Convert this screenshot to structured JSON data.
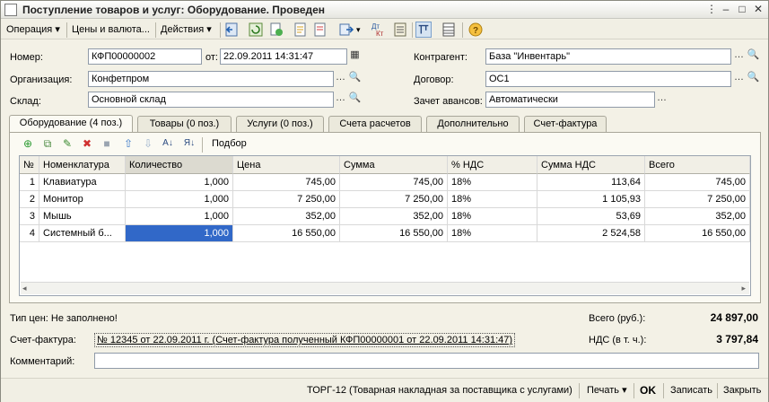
{
  "window": {
    "title": "Поступление товаров и услуг: Оборудование. Проведен"
  },
  "toolbar": {
    "operation": "Операция",
    "prices": "Цены и валюта...",
    "actions": "Действия"
  },
  "form": {
    "number_label": "Номер:",
    "number_value": "КФП00000002",
    "date_label": "от:",
    "date_value": "22.09.2011 14:31:47",
    "org_label": "Организация:",
    "org_value": "Конфетпром",
    "warehouse_label": "Склад:",
    "warehouse_value": "Основной склад",
    "counterparty_label": "Контрагент:",
    "counterparty_value": "База \"Инвентарь\"",
    "contract_label": "Договор:",
    "contract_value": "ОС1",
    "advance_label": "Зачет авансов:",
    "advance_value": "Автоматически"
  },
  "tabs": [
    {
      "label": "Оборудование (4 поз.)"
    },
    {
      "label": "Товары (0 поз.)"
    },
    {
      "label": "Услуги (0 поз.)"
    },
    {
      "label": "Счета расчетов"
    },
    {
      "label": "Дополнительно"
    },
    {
      "label": "Счет-фактура"
    }
  ],
  "grid_toolbar": {
    "select_label": "Подбор"
  },
  "table": {
    "columns": [
      "№",
      "Номенклатура",
      "Количество",
      "Цена",
      "Сумма",
      "% НДС",
      "Сумма НДС",
      "Всего"
    ],
    "rows": [
      [
        "1",
        "Клавиатура",
        "1,000",
        "745,00",
        "745,00",
        "18%",
        "113,64",
        "745,00"
      ],
      [
        "2",
        "Монитор",
        "1,000",
        "7 250,00",
        "7 250,00",
        "18%",
        "1 105,93",
        "7 250,00"
      ],
      [
        "3",
        "Мышь",
        "1,000",
        "352,00",
        "352,00",
        "18%",
        "53,69",
        "352,00"
      ],
      [
        "4",
        "Системный б...",
        "1,000",
        "16 550,00",
        "16 550,00",
        "18%",
        "2 524,58",
        "16 550,00"
      ]
    ]
  },
  "footer": {
    "price_type": "Тип цен: Не заполнено!",
    "total_label": "Всего (руб.):",
    "total_value": "24 897,00",
    "invoice_label": "Счет-фактура:",
    "invoice_value": "№ 12345 от 22.09.2011 г. (Счет-фактура полученный КФП00000001 от 22.09.2011 14:31:47)",
    "vat_label": "НДС (в т. ч.):",
    "vat_value": "3 797,84",
    "comment_label": "Комментарий:",
    "comment_value": ""
  },
  "statusbar": {
    "torg": "ТОРГ-12 (Товарная накладная за поставщика с услугами)",
    "print": "Печать",
    "ok": "OK",
    "save": "Записать",
    "close": "Закрыть"
  }
}
